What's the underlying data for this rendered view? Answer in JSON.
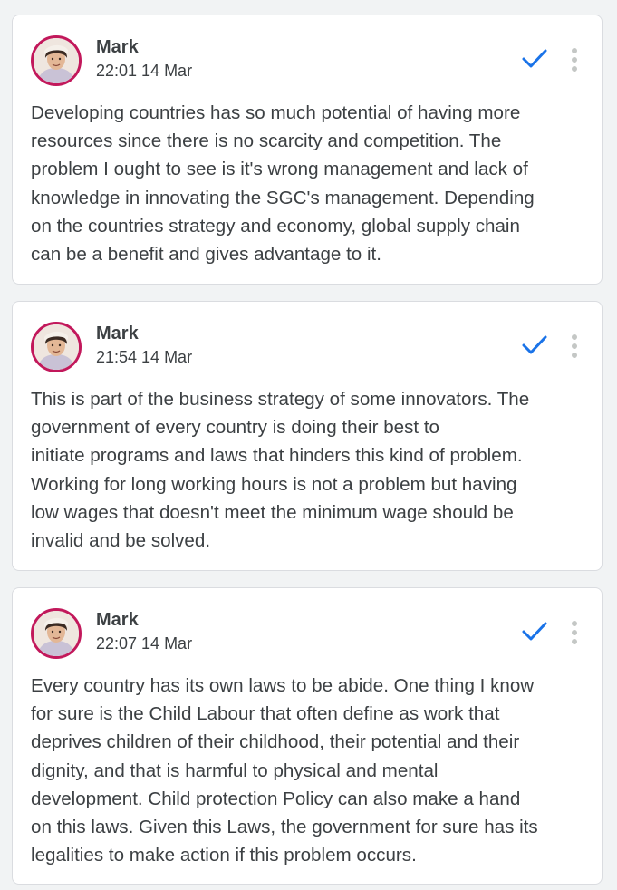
{
  "comments": [
    {
      "author": "Mark",
      "time": "22:01 14 Mar",
      "text": "Developing countries has so much potential of having more\nresources since there is no scarcity and competition. The\nproblem I ought to see is it's wrong management and lack of\nknowledge in innovating the SGC's management. Depending\non the countries strategy and economy, global supply chain\ncan be a benefit and gives advantage to it.",
      "icons": {
        "status": "check-icon",
        "menu": "more-vert-icon"
      }
    },
    {
      "author": "Mark",
      "time": "21:54 14 Mar",
      "text": "This is part of the business  strategy of some innovators. The\ngovernment of every country is doing their best to\ninitiate programs and laws that hinders this kind of problem.\nWorking for long working hours is not a problem but having\nlow wages that doesn't meet the minimum wage should be\ninvalid and be solved.",
      "icons": {
        "status": "check-icon",
        "menu": "more-vert-icon"
      }
    },
    {
      "author": "Mark",
      "time": "22:07 14 Mar",
      "text": "Every country has its own laws to be abide. One thing I know\nfor sure is the Child Labour  that often define as work that\ndeprives children of their childhood, their potential and their\ndignity, and that is harmful to physical and mental\ndevelopment. Child protection Policy can also make a hand\non this laws. Given this Laws, the government for sure has its\nlegalities to make action if this problem occurs.",
      "icons": {
        "status": "check-icon",
        "menu": "more-vert-icon"
      }
    }
  ],
  "colors": {
    "page_background": "#f1f3f4",
    "card_background": "#ffffff",
    "card_border": "#dadce0",
    "text": "#3c4043",
    "check_blue": "#1a73e8",
    "menu_gray": "#c4c7c5",
    "avatar_ring": "#c2185b"
  }
}
